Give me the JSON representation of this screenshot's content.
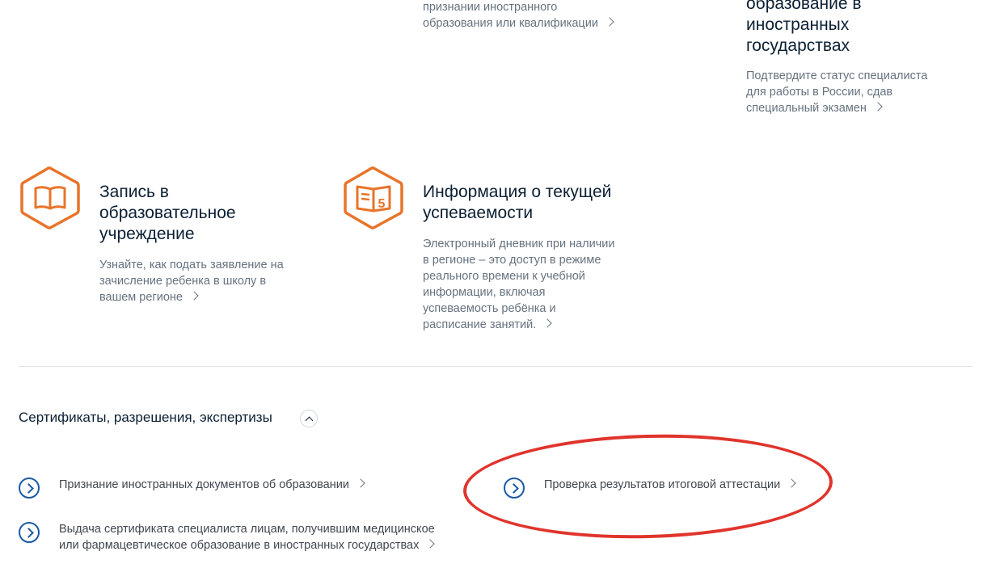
{
  "cards_top": {
    "foreign_recognition": {
      "desc_lines": [
        "признании иностранного",
        "образования или квалификации"
      ]
    },
    "foreign_states": {
      "title_lines": [
        "образование в",
        "иностранных",
        "государствах"
      ],
      "desc_lines": [
        "Подтвердите статус специалиста",
        "для работы в России, сдав",
        "специальный экзамен"
      ]
    }
  },
  "cards": {
    "school_enrollment": {
      "icon": "book-icon",
      "title_lines": [
        "Запись в",
        "образовательное",
        "учреждение"
      ],
      "desc_lines": [
        "Узнайте, как подать заявление на",
        "зачисление ребенка в школу в",
        "вашем регионе"
      ]
    },
    "performance_info": {
      "icon": "diary-grade-icon",
      "title_lines": [
        "Информация о текущей",
        "успеваемости"
      ],
      "desc_lines": [
        "Электронный дневник при наличии",
        "в регионе – это доступ в режиме",
        "реального времени к учебной",
        "информации, включая",
        "успеваемость ребёнка и",
        "расписание занятий."
      ]
    }
  },
  "section": {
    "title": "Сертификаты, разрешения, экспертизы"
  },
  "links": {
    "recognition": "Признание иностранных документов об образовании",
    "certificate_lines": [
      "Выдача сертификата специалиста лицам, получившим медицинское",
      "или фармацевтическое образование в иностранных государствах"
    ],
    "attestation": "Проверка результатов итоговой аттестации"
  },
  "colors": {
    "accent_orange": "#e8742a",
    "link_icon_blue": "#1a5aa6",
    "annotation_red": "#e0342c"
  }
}
